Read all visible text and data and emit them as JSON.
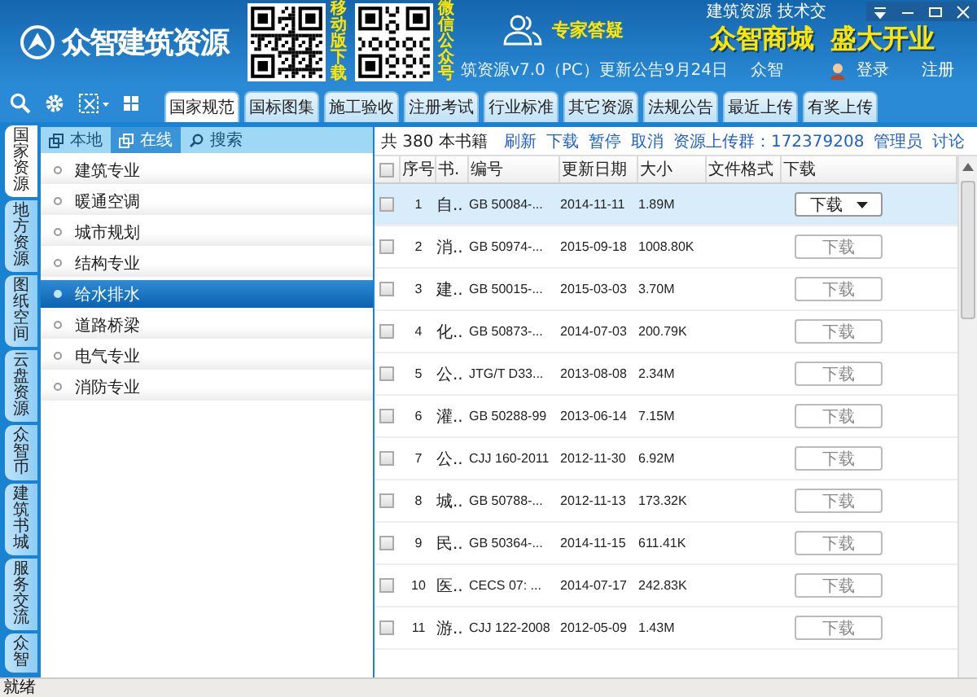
{
  "header": {
    "logo_text": "众智建筑资源",
    "qr_captions": [
      "移动版下载",
      "微信公众号"
    ],
    "expert_label": "专家答疑",
    "top_text": "建筑资源 技术交",
    "promo": [
      "众智商城",
      "盛大开业"
    ],
    "notice": "筑资源v7.0（PC）更新公告9月24日",
    "notice_author": "众智",
    "login": "登录",
    "register": "注册"
  },
  "tabs": [
    {
      "label": "国家规范",
      "selected": true
    },
    {
      "label": "国标图集",
      "selected": false
    },
    {
      "label": "施工验收",
      "selected": false
    },
    {
      "label": "注册考试",
      "selected": false
    },
    {
      "label": "行业标准",
      "selected": false
    },
    {
      "label": "其它资源",
      "selected": false
    },
    {
      "label": "法规公告",
      "selected": false
    },
    {
      "label": "最近上传",
      "selected": false
    },
    {
      "label": "有奖上传",
      "selected": false
    }
  ],
  "side_tabs": [
    {
      "label": "国家资源",
      "selected": true
    },
    {
      "label": "地方资源",
      "selected": false
    },
    {
      "label": "图纸空间",
      "selected": false
    },
    {
      "label": "云盘资源",
      "selected": false
    },
    {
      "label": "众智币",
      "selected": false
    },
    {
      "label": "建筑书城",
      "selected": false
    },
    {
      "label": "服务交流",
      "selected": false
    },
    {
      "label": "众智",
      "selected": false
    }
  ],
  "source_tabs": [
    {
      "label": "本地",
      "selected": false
    },
    {
      "label": "在线",
      "selected": true
    },
    {
      "label": "搜索",
      "selected": false
    }
  ],
  "categories": [
    {
      "label": "建筑专业",
      "selected": false
    },
    {
      "label": "暖通空调",
      "selected": false
    },
    {
      "label": "城市规划",
      "selected": false
    },
    {
      "label": "结构专业",
      "selected": false
    },
    {
      "label": "给水排水",
      "selected": true
    },
    {
      "label": "道路桥梁",
      "selected": false
    },
    {
      "label": "电气专业",
      "selected": false
    },
    {
      "label": "消防专业",
      "selected": false
    }
  ],
  "summary": "共 380 本书籍",
  "actions": [
    "刷新",
    "下载",
    "暂停",
    "取消",
    "资源上传群：172379208",
    "管理员",
    "讨论"
  ],
  "table": {
    "all_checked": false,
    "columns": [
      "序号",
      "书.",
      "编号",
      "更新日期",
      "大小",
      "文件格式",
      "下载"
    ],
    "rows": [
      {
        "no": "1",
        "title": "自..",
        "code": "GB 50084-...",
        "date": "2014-11-11",
        "size": "1.89M",
        "button": "下载",
        "checked": false,
        "selected": true
      },
      {
        "no": "2",
        "title": "消..",
        "code": "GB 50974-...",
        "date": "2015-09-18",
        "size": "1008.80K",
        "button": "下载",
        "checked": false,
        "selected": false
      },
      {
        "no": "3",
        "title": "建..",
        "code": "GB 50015-...",
        "date": "2015-03-03",
        "size": "3.70M",
        "button": "下载",
        "checked": false,
        "selected": false
      },
      {
        "no": "4",
        "title": "化..",
        "code": "GB 50873-...",
        "date": "2014-07-03",
        "size": "200.79K",
        "button": "下载",
        "checked": false,
        "selected": false
      },
      {
        "no": "5",
        "title": "公..",
        "code": "JTG/T D33...",
        "date": "2013-08-08",
        "size": "2.34M",
        "button": "下载",
        "checked": false,
        "selected": false
      },
      {
        "no": "6",
        "title": "灌..",
        "code": "GB 50288-99",
        "date": "2013-06-14",
        "size": "7.15M",
        "button": "下载",
        "checked": false,
        "selected": false
      },
      {
        "no": "7",
        "title": "公..",
        "code": "CJJ 160-2011",
        "date": "2012-11-30",
        "size": "6.92M",
        "button": "下载",
        "checked": false,
        "selected": false
      },
      {
        "no": "8",
        "title": "城..",
        "code": "GB 50788-...",
        "date": "2012-11-13",
        "size": "173.32K",
        "button": "下载",
        "checked": false,
        "selected": false
      },
      {
        "no": "9",
        "title": "民..",
        "code": "GB 50364-...",
        "date": "2014-11-15",
        "size": "611.41K",
        "button": "下载",
        "checked": false,
        "selected": false
      },
      {
        "no": "10",
        "title": "医..",
        "code": "CECS 07: ...",
        "date": "2014-07-17",
        "size": "242.83K",
        "button": "下载",
        "checked": false,
        "selected": false
      },
      {
        "no": "11",
        "title": "游..",
        "code": "CJJ 122-2008",
        "date": "2012-05-09",
        "size": "1.43M",
        "button": "下载",
        "checked": false,
        "selected": false
      }
    ]
  },
  "status_bar": "就绪"
}
